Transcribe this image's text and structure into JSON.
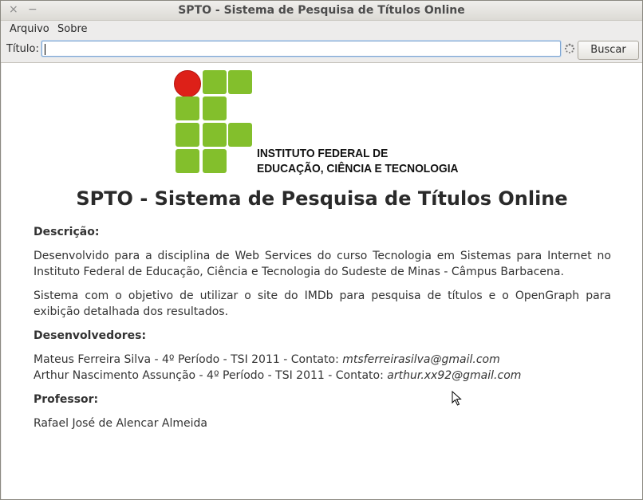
{
  "window": {
    "title": "SPTO - Sistema de Pesquisa de Títulos Online",
    "close_glyph": "×",
    "minimize_glyph": "−"
  },
  "menu": {
    "items": [
      "Arquivo",
      "Sobre"
    ]
  },
  "search": {
    "label": "Título:",
    "value": "",
    "button": "Buscar"
  },
  "logo": {
    "line1": "INSTITUTO FEDERAL DE",
    "line2": "EDUCAÇÃO, CIÊNCIA E TECNOLOGIA",
    "green": "#83bf2c",
    "red": "#dd2018"
  },
  "page": {
    "heading": "SPTO - Sistema de Pesquisa de Títulos Online",
    "descricao_label": "Descrição:",
    "descricao_p1": "Desenvolvido para a disciplina de Web Services do curso Tecnologia em Sistemas para Internet no Instituto Federal de Educação, Ciência e Tecnologia do Sudeste de Minas - Câmpus Barbacena.",
    "descricao_p2": "Sistema com o objetivo de utilizar o site do IMDb para pesquisa de títulos e o OpenGraph para exibição detalhada dos resultados.",
    "desenvolvedores_label": "Desenvolvedores:",
    "dev1_text": "Mateus Ferreira Silva - 4º Período - TSI 2011 - Contato: ",
    "dev1_email": "mtsferreirasilva@gmail.com",
    "dev2_text": "Arthur Nascimento Assunção - 4º Período - TSI 2011 - Contato: ",
    "dev2_email": "arthur.xx92@gmail.com",
    "professor_label": "Professor:",
    "professor_name": "Rafael José de Alencar Almeida"
  }
}
